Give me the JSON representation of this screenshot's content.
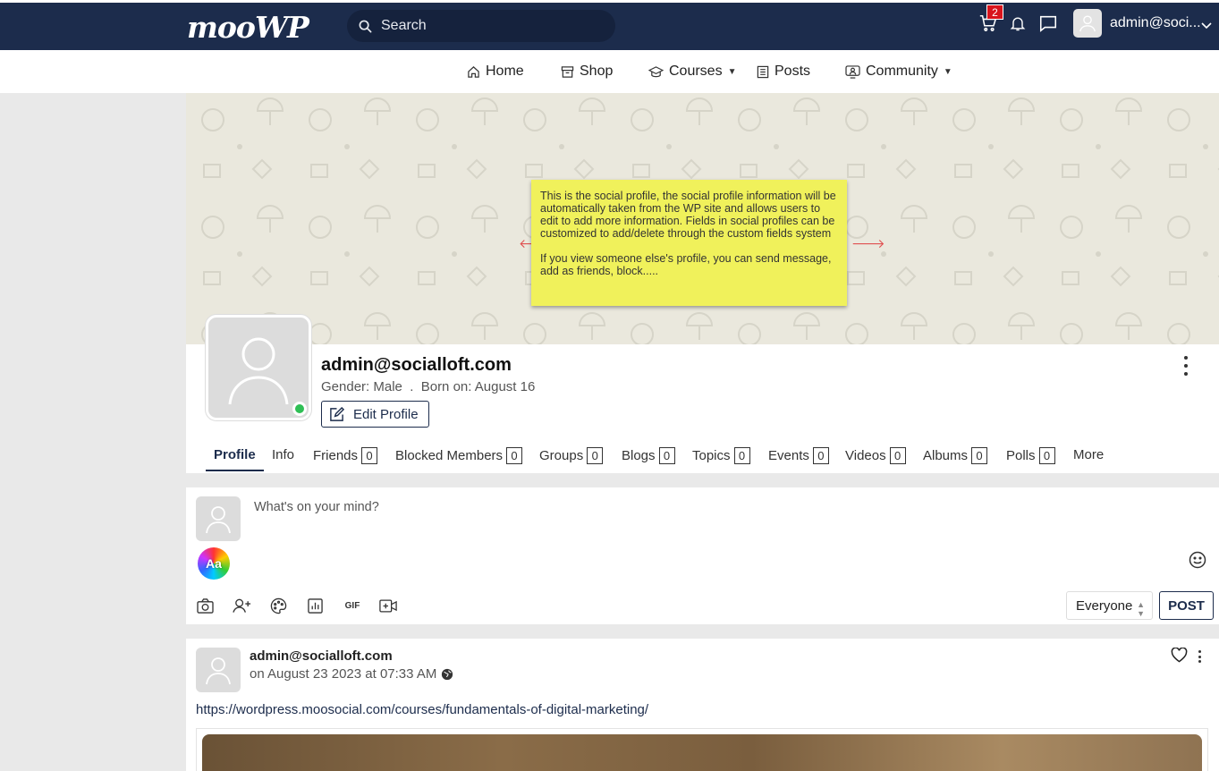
{
  "header": {
    "logo": "mooWP",
    "search_placeholder": "Search",
    "cart_count": "2",
    "user_name": "admin@soci..."
  },
  "nav": {
    "items": [
      {
        "label": "Home",
        "icon": "home-icon"
      },
      {
        "label": "Shop",
        "icon": "shop-icon"
      },
      {
        "label": "Courses",
        "icon": "graduation-cap-icon",
        "has_dropdown": true
      },
      {
        "label": "Posts",
        "icon": "posts-icon"
      },
      {
        "label": "Community",
        "icon": "community-icon",
        "has_dropdown": true
      }
    ]
  },
  "tooltip": {
    "paragraph1": "This is the social profile, the social profile information will be automatically taken from the WP site and allows users to edit to add more information. Fields in social profiles can be customized to add/delete through the custom fields system",
    "paragraph2": "If you view someone else's profile, you can send message, add as friends, block....."
  },
  "profile": {
    "name": "admin@socialloft.com",
    "meta": "Gender: Male  .  Born on: August 16",
    "edit_label": "Edit Profile",
    "online": true
  },
  "tabs": [
    {
      "label": "Profile",
      "active": true
    },
    {
      "label": "Info"
    },
    {
      "label": "Friends",
      "count": "0"
    },
    {
      "label": "Blocked Members",
      "count": "0"
    },
    {
      "label": "Groups",
      "count": "0"
    },
    {
      "label": "Blogs",
      "count": "0"
    },
    {
      "label": "Topics",
      "count": "0"
    },
    {
      "label": "Events",
      "count": "0"
    },
    {
      "label": "Videos",
      "count": "0"
    },
    {
      "label": "Albums",
      "count": "0"
    },
    {
      "label": "Polls",
      "count": "0"
    },
    {
      "label": "More"
    }
  ],
  "composer": {
    "placeholder": "What's on your mind?",
    "aa_label": "Aa",
    "gif_label": "GIF",
    "privacy_value": "Everyone",
    "post_label": "POST"
  },
  "feed": {
    "author": "admin@socialloft.com",
    "time": "on August 23 2023 at 07:33 AM",
    "link": "https://wordpress.moosocial.com/courses/fundamentals-of-digital-marketing/"
  },
  "colors": {
    "header_bg": "#1c2c4c",
    "tooltip_bg": "#f0f15b",
    "online": "#2fbf55",
    "badge": "#d8141c"
  }
}
